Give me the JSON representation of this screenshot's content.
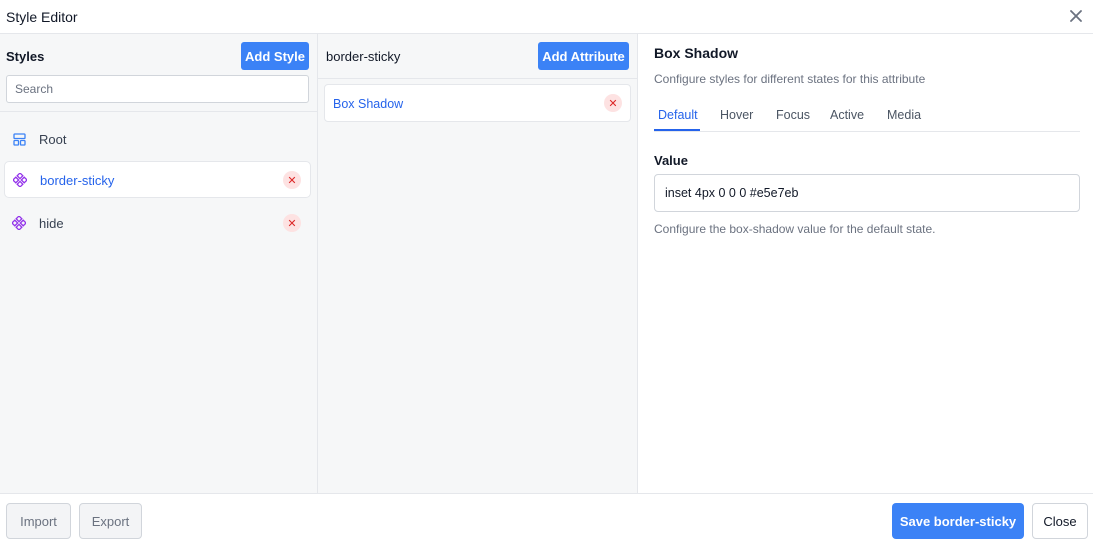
{
  "window": {
    "title": "Style Editor"
  },
  "styles_panel": {
    "label": "Styles",
    "add_button": "Add Style",
    "search_placeholder": "Search",
    "items": [
      {
        "label": "Root",
        "icon": "layout-icon"
      },
      {
        "label": "border-sticky",
        "icon": "component-icon",
        "selected": true,
        "removable": true
      },
      {
        "label": "hide",
        "icon": "component-icon",
        "removable": true
      }
    ]
  },
  "attributes_panel": {
    "label": "border-sticky",
    "add_button": "Add Attribute",
    "items": [
      {
        "label": "Box Shadow",
        "removable": true
      }
    ]
  },
  "detail_panel": {
    "title": "Box Shadow",
    "subtitle": "Configure styles for different states for this attribute",
    "tabs": [
      "Default",
      "Hover",
      "Focus",
      "Active",
      "Media"
    ],
    "active_tab": "Default",
    "value_label": "Value",
    "value": "inset 4px 0 0 0 #e5e7eb",
    "help": "Configure the box-shadow value for the default state."
  },
  "footer": {
    "import": "Import",
    "export": "Export",
    "save": "Save border-sticky",
    "close": "Close"
  },
  "colors": {
    "primary": "#3b82f6",
    "active_text": "#2563eb",
    "danger": "#dc2626",
    "danger_bg": "#fde2e2",
    "component_icon": "#9333ea"
  }
}
